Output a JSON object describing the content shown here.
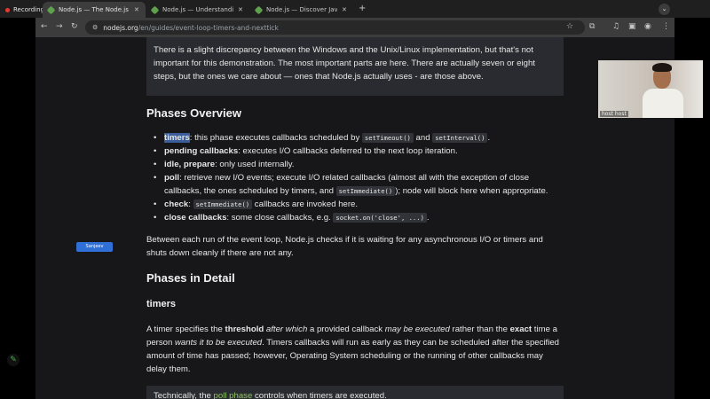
{
  "browser": {
    "recording_label": "Recording",
    "tabs": [
      {
        "title": "Node.js — The Node.js Event",
        "active": true
      },
      {
        "title": "Node.js — Understanding pr",
        "active": false
      },
      {
        "title": "Node.js — Discover JavaScri",
        "active": false
      }
    ],
    "url_host": "nodejs.org",
    "url_path": "/en/guides/event-loop-timers-and-nexttick"
  },
  "page": {
    "note1": "There is a slight discrepancy between the Windows and the Unix/Linux implementation, but that's not important for this demonstration. The most important parts are here. There are actually seven or eight steps, but the ones we care about — ones that Node.js actually uses - are those above.",
    "phases_overview_heading": "Phases Overview",
    "phases": {
      "timers": {
        "term": "timers",
        "t1": ": this phase executes callbacks scheduled by ",
        "c1": "setTimeout()",
        "t2": " and ",
        "c2": "setInterval()",
        "t3": "."
      },
      "pending": {
        "term": "pending callbacks",
        "text": ": executes I/O callbacks deferred to the next loop iteration."
      },
      "idle": {
        "term": "idle, prepare",
        "text": ": only used internally."
      },
      "poll": {
        "term": "poll",
        "t1": ": retrieve new I/O events; execute I/O related callbacks (almost all with the exception of close callbacks, the ones scheduled by timers, and ",
        "c1": "setImmediate()",
        "t2": "); node will block here when appropriate."
      },
      "check": {
        "term": "check",
        "t1": ": ",
        "c1": "setImmediate()",
        "t2": " callbacks are invoked here."
      },
      "close": {
        "term": "close callbacks",
        "t1": ": some close callbacks, e.g. ",
        "c1": "socket.on('close', ...)",
        "t2": "."
      }
    },
    "between_paragraph": "Between each run of the event loop, Node.js checks if it is waiting for any asynchronous I/O or timers and shuts down cleanly if there are not any.",
    "phases_detail_heading": "Phases in Detail",
    "timers_heading": "timers",
    "timers_paragraph": {
      "t1": "A timer specifies the ",
      "b1": "threshold",
      "t2": " ",
      "i1": "after which",
      "t3": " a provided callback ",
      "i2": "may be executed",
      "t4": " rather than the ",
      "b2": "exact",
      "t5": " time a person ",
      "i3": "wants it to be executed",
      "t6": ". Timers callbacks will run as early as they can be scheduled after the specified amount of time has passed; however, Operating System scheduling or the running of other callbacks may delay them."
    },
    "note2": {
      "t1": "Technically, the ",
      "link": "poll phase",
      "t2": " controls when timers are executed."
    }
  },
  "overlay": {
    "presenter_name": "host host",
    "side_chip_label": "Sanjeev"
  }
}
